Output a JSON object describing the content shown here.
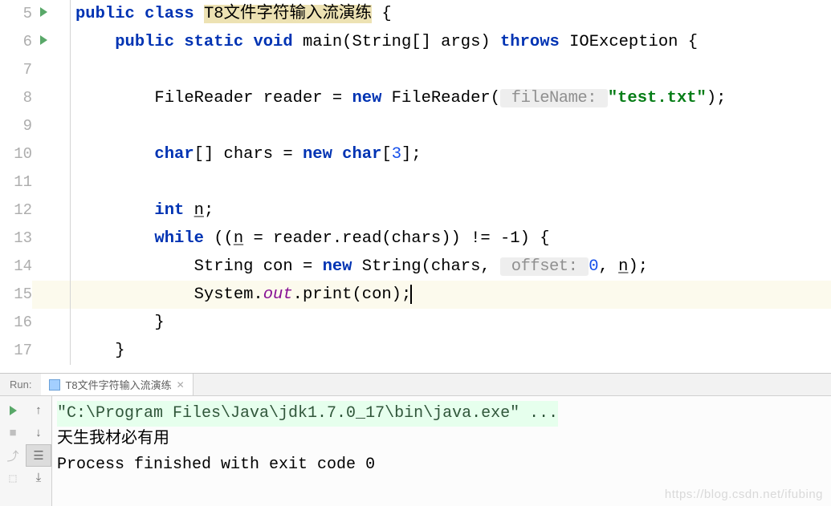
{
  "lines": {
    "5": {
      "before": "public class ",
      "class_name": "T8文件字符输入流演练",
      "after": " {"
    },
    "6": "    public static void main(String[] args) throws IOException {",
    "7": "",
    "8": {
      "pre": "        FileReader reader = ",
      "kw_new": "new",
      "mid": " FileReader(",
      "hint": " fileName: ",
      "str": "\"test.txt\"",
      "post": ");"
    },
    "9": "",
    "10": {
      "pre": "        ",
      "kw_char": "char",
      "mid1": "[] chars = ",
      "kw_new": "new char",
      "mid2": "[",
      "num": "3",
      "post": "];"
    },
    "11": "",
    "12": {
      "pre": "        ",
      "kw_int": "int",
      "mid": " ",
      "var": "n",
      "post": ";"
    },
    "13": {
      "pre": "        ",
      "kw_while": "while",
      "mid1": " ((",
      "var_n1": "n",
      "mid2": " = reader.read(chars)) != -1) {"
    },
    "14": {
      "pre": "            String con = ",
      "kw_new": "new",
      "mid1": " String(chars, ",
      "hint": " offset: ",
      "num": "0",
      "mid2": ", ",
      "var_n": "n",
      "post": ");"
    },
    "15": {
      "pre": "            System.",
      "out": "out",
      "post": ".print(con);"
    },
    "16": "        }",
    "17": "    }"
  },
  "gutter": [
    "5",
    "6",
    "7",
    "8",
    "9",
    "10",
    "11",
    "12",
    "13",
    "14",
    "15",
    "16",
    "17"
  ],
  "run": {
    "panel_label": "Run:",
    "tab_name": "T8文件字符输入流演练",
    "cmd_line": "\"C:\\Program Files\\Java\\jdk1.7.0_17\\bin\\java.exe\" ...",
    "output_line": "天生我材必有用",
    "exit_line": "Process finished with exit code 0"
  },
  "watermark": "https://blog.csdn.net/ifubing"
}
